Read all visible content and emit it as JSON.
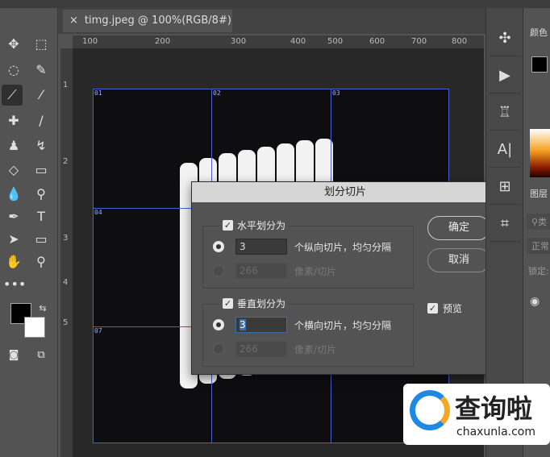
{
  "document_tab": {
    "title": "timg.jpeg @ 100%(RGB/8#)"
  },
  "ruler_top": [
    "100",
    "200",
    "300",
    "400",
    "500",
    "600",
    "700",
    "800"
  ],
  "ruler_left": [
    "1",
    "2",
    "3",
    "4",
    "5"
  ],
  "slices": [
    "01",
    "02",
    "03",
    "04",
    "07"
  ],
  "toolbar": {
    "more": "•••"
  },
  "dialog": {
    "title": "划分切片",
    "horizontal": {
      "label": "水平划分为",
      "count": "3",
      "count_label": "个纵向切片，均匀分隔",
      "pixels": "266",
      "pixels_label": "像素/切片"
    },
    "vertical": {
      "label": "垂直划分为",
      "count": "3",
      "count_label": "个横向切片，均匀分隔",
      "pixels": "266",
      "pixels_label": "像素/切片"
    },
    "ok": "确定",
    "cancel": "取消",
    "preview": "预览"
  },
  "right_panel": {
    "color": "颜色",
    "layers": "图层",
    "blend": "正常",
    "lock": "锁定:",
    "search": "类"
  },
  "watermark": {
    "brand": "查询啦",
    "url": "chaxunla.com"
  }
}
